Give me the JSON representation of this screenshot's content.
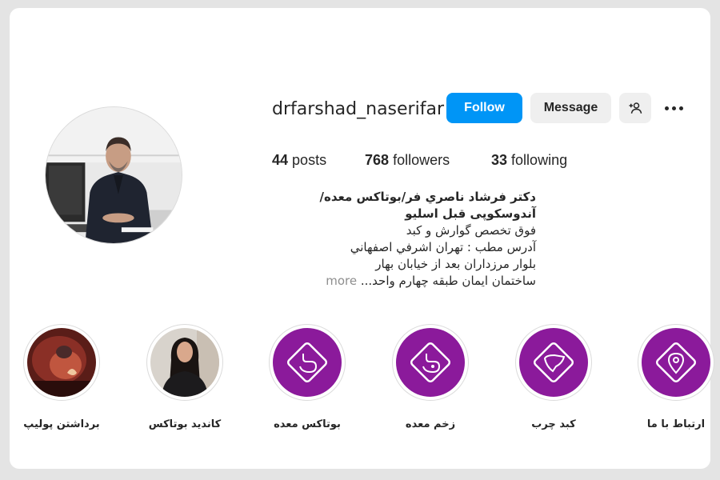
{
  "profile": {
    "username": "drfarshad_naserifar",
    "follow_label": "Follow",
    "message_label": "Message",
    "add_user_icon": "person-add-icon",
    "more_icon": "more-horizontal-icon"
  },
  "stats": {
    "posts_count": "44",
    "posts_label": "posts",
    "followers_count": "768",
    "followers_label": "followers",
    "following_count": "33",
    "following_label": "following"
  },
  "bio": {
    "name": "دکتر فرشاد ناصري فر/بوتاکس معده/آندوسکوپی قبل اسلیو",
    "lines": [
      "فوق تخصص گوارش و کبد",
      "آدرس مطب : تهران اشرفي اصفهاني",
      "بلوار مرزداران بعد از خيابان بهار",
      "ساختمان ايمان طبقه چهارم واحد..."
    ],
    "more_label": "more"
  },
  "highlights": [
    {
      "label": "برداشتن پولیپ",
      "icon": "endoscopy-photo"
    },
    {
      "label": "کاندید بوتاکس",
      "icon": "woman-photo"
    },
    {
      "label": "بوتاکس معده",
      "icon": "stomach-icon"
    },
    {
      "label": "زخم معده",
      "icon": "stomach-ulcer-icon"
    },
    {
      "label": "کبد چرب",
      "icon": "liver-icon"
    },
    {
      "label": "ارتباط با ما",
      "icon": "location-pin-icon"
    }
  ],
  "colors": {
    "follow_blue": "#0095f6",
    "highlight_purple": "#8b1a9b",
    "button_gray": "#efefef"
  }
}
